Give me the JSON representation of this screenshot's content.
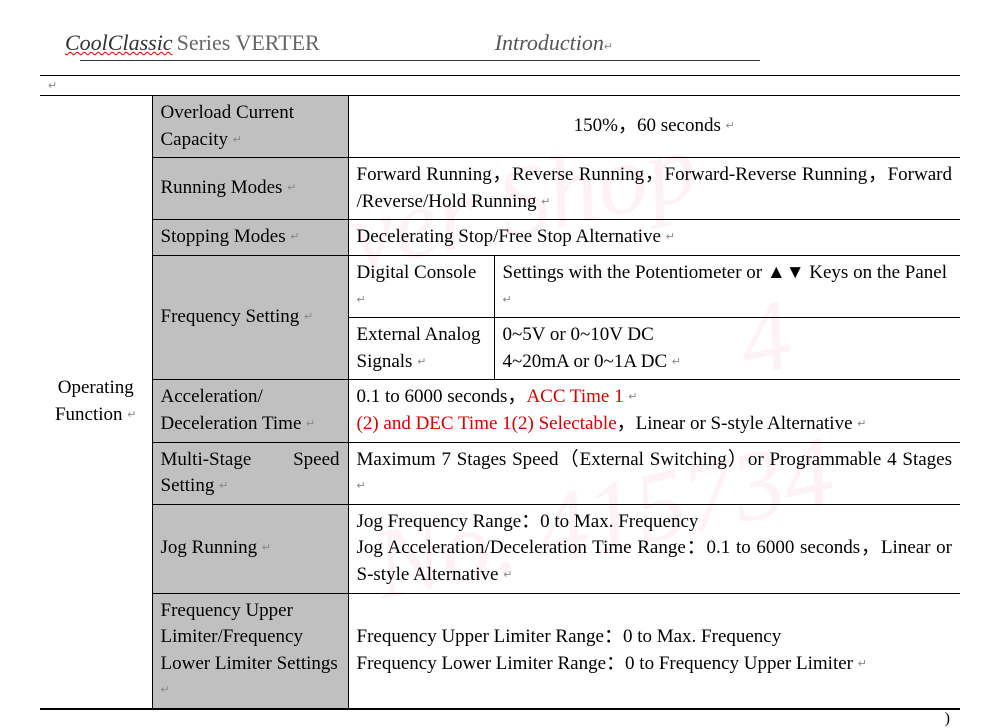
{
  "header": {
    "brand": "CoolClassic",
    "series": " Series VERTER",
    "intro": "Introduction"
  },
  "col1": "Operating Function",
  "rows": {
    "overload_label": "Overload Current Capacity",
    "overload_value": "150%，60 seconds",
    "running_modes_label": "Running Modes",
    "running_modes_value": "Forward Running，Reverse Running，Forward-Reverse Running，Forward /Reverse/Hold Running",
    "stopping_label": "Stopping Modes",
    "stopping_value": "Decelerating Stop/Free Stop Alternative",
    "freq_setting_label": "Frequency Setting",
    "freq_digital_label": "Digital Console",
    "freq_digital_value_pre": "Settings with the Potentiometer or ",
    "freq_digital_value_post": " Keys on the Panel",
    "freq_ext_label": "External Analog Signals",
    "freq_ext_value": "0~5V or 0~10V DC\n4~20mA or 0~1A DC",
    "accel_label": "Acceleration/ Deceleration Time",
    "accel_value_plain1": "0.1 to 6000 seconds，",
    "accel_value_red1": "ACC Time 1",
    "accel_value_red2": "(2) and DEC Time 1(2) Selectable",
    "accel_value_plain2": "，Linear or S-style Alternative",
    "multi_label": "Multi-Stage Speed Setting",
    "multi_value": "Maximum 7 Stages Speed（External Switching）or Programmable 4 Stages",
    "jog_label": "Jog Running",
    "jog_value": "Jog Frequency Range：0 to Max. Frequency\nJog Acceleration/Deceleration Time Range：0.1 to 6000 seconds，Linear or S-style Alternative",
    "limiter_label": "Frequency Upper Limiter/Frequency Lower Limiter Settings",
    "limiter_value": "Frequency Upper Limiter Range：0 to Max. Frequency\nFrequency Lower Limiter Range：0 to Frequency Upper Limiter"
  },
  "watermark": {
    "line1": "Bill River Shop",
    "line2": "No. 415734"
  }
}
